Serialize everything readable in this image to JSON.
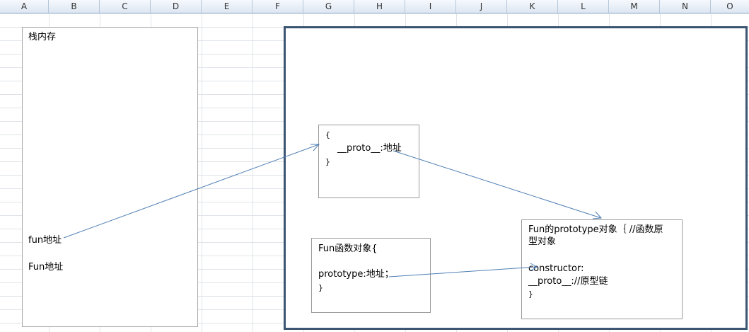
{
  "columns": [
    "A",
    "B",
    "C",
    "D",
    "E",
    "F",
    "G",
    "H",
    "I",
    "J",
    "K",
    "L",
    "M",
    "N",
    "O"
  ],
  "stack": {
    "title": "栈内存",
    "fun_lower": "fun地址",
    "fun_upper": "Fun地址"
  },
  "instance_box": {
    "open": "{",
    "proto_line": "__proto__:地址",
    "close": "}"
  },
  "function_box": {
    "line1": "Fun函数对象{",
    "line2": "prototype:地址；",
    "close": "}"
  },
  "prototype_box": {
    "line1": "Fun的prototype对象｛ //函数原",
    "line2": "型对象",
    "line3": "constructor:",
    "line4": "__proto__://原型链",
    "close": "}"
  },
  "colors": {
    "arrow": "#4f7fb5",
    "heap_border": "#3c5572"
  }
}
